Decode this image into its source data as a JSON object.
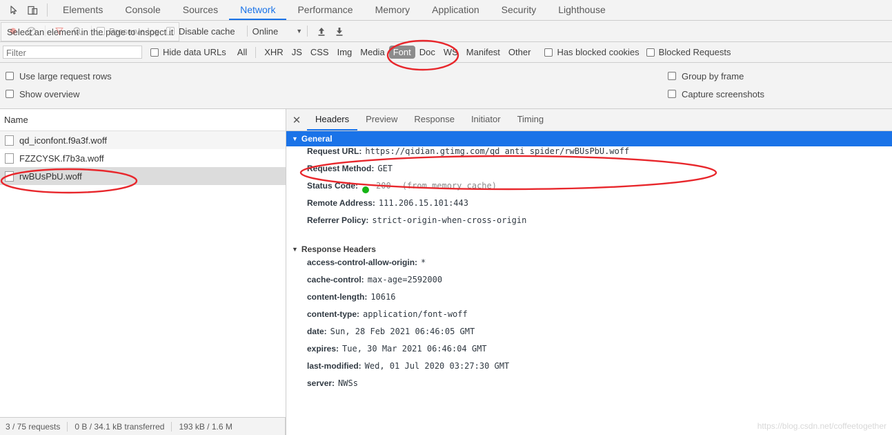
{
  "colors": {
    "accent": "#1a73e8",
    "toolbar_bg": "#f3f3f3",
    "annotation_red": "#e8272c",
    "selected_filter_bg": "#8c8c8c",
    "status_green": "#15b415",
    "watermark": "#d8d8d8"
  },
  "tabbar": {
    "icons": [
      {
        "name": "inspect-element-icon",
        "glyph": "↖"
      },
      {
        "name": "device-toolbar-icon",
        "glyph": "⎕"
      }
    ],
    "tabs": [
      {
        "label": "Elements",
        "selected": false
      },
      {
        "label": "Console",
        "selected": false
      },
      {
        "label": "Sources",
        "selected": false
      },
      {
        "label": "Network",
        "selected": true
      },
      {
        "label": "Performance",
        "selected": false
      },
      {
        "label": "Memory",
        "selected": false
      },
      {
        "label": "Application",
        "selected": false
      },
      {
        "label": "Security",
        "selected": false
      },
      {
        "label": "Lighthouse",
        "selected": false
      }
    ]
  },
  "tooltip": {
    "text": "Select an element in the page to inspect it"
  },
  "net_toolbar": {
    "record_icon": "record-icon",
    "clear_icon": "clear-icon",
    "filter_icon": "filter-icon",
    "search_icon": "search-icon",
    "preserve_log_label": "Preserve log",
    "disable_cache_label": "Disable cache",
    "throttle_value": "Online",
    "caret": "▼",
    "import_icon": "import-har-icon",
    "export_icon": "export-har-icon"
  },
  "filterbar": {
    "filter_placeholder": "Filter",
    "filter_value": "",
    "hide_data_urls_label": "Hide data URLs",
    "types": [
      {
        "label": "All",
        "selected": false
      },
      {
        "label": "XHR",
        "selected": false
      },
      {
        "label": "JS",
        "selected": false
      },
      {
        "label": "CSS",
        "selected": false
      },
      {
        "label": "Img",
        "selected": false
      },
      {
        "label": "Media",
        "selected": false
      },
      {
        "label": "Font",
        "selected": true
      },
      {
        "label": "Doc",
        "selected": false
      },
      {
        "label": "WS",
        "selected": false
      },
      {
        "label": "Manifest",
        "selected": false
      },
      {
        "label": "Other",
        "selected": false
      }
    ],
    "has_blocked_cookies_label": "Has blocked cookies",
    "blocked_requests_label": "Blocked Requests"
  },
  "settings": {
    "use_large_request_rows_label": "Use large request rows",
    "show_overview_label": "Show overview",
    "group_by_frame_label": "Group by frame",
    "capture_screenshots_label": "Capture screenshots"
  },
  "requests": {
    "column_header": "Name",
    "rows": [
      {
        "name": "qd_iconfont.f9a3f.woff",
        "selected": false
      },
      {
        "name": "FZZCYSK.f7b3a.woff",
        "selected": false
      },
      {
        "name": "rwBUsPbU.woff",
        "selected": true
      }
    ]
  },
  "detail": {
    "close_glyph": "✕",
    "tabs": [
      {
        "label": "Headers",
        "selected": true
      },
      {
        "label": "Preview",
        "selected": false
      },
      {
        "label": "Response",
        "selected": false
      },
      {
        "label": "Initiator",
        "selected": false
      },
      {
        "label": "Timing",
        "selected": false
      }
    ],
    "general": {
      "title": "General",
      "triangle": "▼",
      "items": [
        {
          "key": "Request URL:",
          "value": "https://qidian.gtimg.com/qd_anti_spider/rwBUsPbU.woff"
        },
        {
          "key": "Request Method:",
          "value": "GET"
        },
        {
          "key": "Status Code:",
          "value": "200",
          "dim": true,
          "dot": true,
          "note": "(from memory cache)"
        },
        {
          "key": "Remote Address:",
          "value": "111.206.15.101:443"
        },
        {
          "key": "Referrer Policy:",
          "value": "strict-origin-when-cross-origin"
        }
      ]
    },
    "response_headers": {
      "title": "Response Headers",
      "triangle": "▼",
      "items": [
        {
          "key": "access-control-allow-origin:",
          "value": "*"
        },
        {
          "key": "cache-control:",
          "value": "max-age=2592000"
        },
        {
          "key": "content-length:",
          "value": "10616"
        },
        {
          "key": "content-type:",
          "value": "application/font-woff"
        },
        {
          "key": "date:",
          "value": "Sun, 28 Feb 2021 06:46:05 GMT"
        },
        {
          "key": "expires:",
          "value": "Tue, 30 Mar 2021 06:46:04 GMT"
        },
        {
          "key": "last-modified:",
          "value": "Wed, 01 Jul 2020 03:27:30 GMT"
        },
        {
          "key": "server:",
          "value": "NWSs"
        }
      ]
    }
  },
  "statusbar": {
    "requests": "3 / 75 requests",
    "transferred": "0 B / 34.1 kB transferred",
    "resources": "193 kB / 1.6 M"
  },
  "watermark": {
    "text": "https://blog.csdn.net/coffeetogether"
  }
}
